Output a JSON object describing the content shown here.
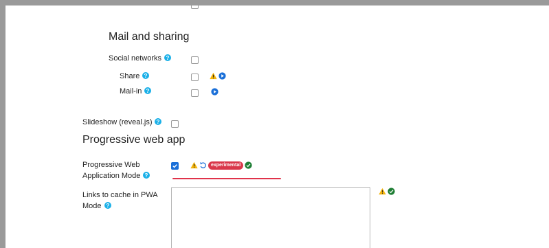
{
  "sections": {
    "mail": {
      "heading": "Mail and sharing",
      "rows": [
        {
          "label": "Social networks"
        },
        {
          "label": "Share"
        },
        {
          "label": "Mail-in"
        }
      ]
    },
    "slideshow": {
      "label": "Slideshow (reveal.js)"
    },
    "pwa": {
      "heading": "Progressive web app",
      "mode_label": "Progressive Web Application Mode",
      "experimental_badge": "experimental",
      "cache_label": "Links to cache in PWA Mode"
    }
  },
  "colors": {
    "help": "#1ab0e8",
    "warning": "#f5b50a",
    "preview": "#1a6fd8",
    "ok": "#1e7e34",
    "badge": "#d9374a",
    "underline": "#e0334a"
  }
}
